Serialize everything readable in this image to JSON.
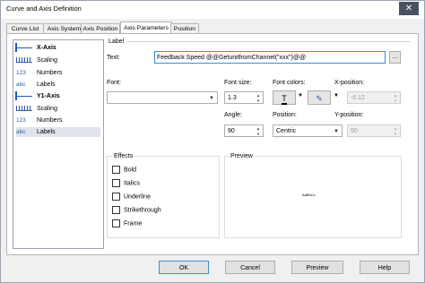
{
  "window": {
    "title": "Curve and Axis Definition",
    "close_glyph": "✕"
  },
  "tabs": [
    {
      "label": "Curve List"
    },
    {
      "label": "Axis System"
    },
    {
      "label": "Axis Position"
    },
    {
      "label": "Axis Parameters"
    },
    {
      "label": "Position"
    }
  ],
  "tree": {
    "items": [
      {
        "label": "X-Axis",
        "icon": "axis-line-icon",
        "bold": true
      },
      {
        "label": "Scaling",
        "icon": "scaling-icon"
      },
      {
        "label": "Numbers",
        "icon_text": "123"
      },
      {
        "label": "Labels",
        "icon_text": "abc"
      },
      {
        "label": "Y1-Axis",
        "icon": "axis-line-icon",
        "bold": true
      },
      {
        "label": "Scaling",
        "icon": "scaling-icon"
      },
      {
        "label": "Numbers",
        "icon_text": "123"
      },
      {
        "label": "Labels",
        "icon_text": "abc",
        "selected": true
      }
    ]
  },
  "label_group": {
    "title": "Label",
    "text_label": "Text:",
    "text_value": "Feedback Speed @@GetunitfromChannel(\"xxx\")@@",
    "text_button": "...",
    "font_label": "Font:",
    "font_value": "",
    "font_size_label": "Font size:",
    "font_size_value": "1.3",
    "font_colors_label": "Font colors:",
    "x_position_label": "X-position:",
    "x_position_value": "-6.12",
    "angle_label": "Angle:",
    "angle_value": "90",
    "position_label": "Position:",
    "position_value": "Centric",
    "y_position_label": "Y-position:",
    "y_position_value": "50"
  },
  "effects": {
    "title": "Effects",
    "options": [
      "Bold",
      "Italics",
      "Underline",
      "Strikethrough",
      "Frame"
    ]
  },
  "preview": {
    "title": "Preview",
    "sample": "AaBbCc"
  },
  "buttons": {
    "ok": "OK",
    "cancel": "Cancel",
    "preview": "Preview",
    "help": "Help"
  },
  "colors": {
    "accent": "#3c8ed6",
    "tree_icon": "#2b5ca8",
    "titlebar_close": "#4a5262"
  }
}
